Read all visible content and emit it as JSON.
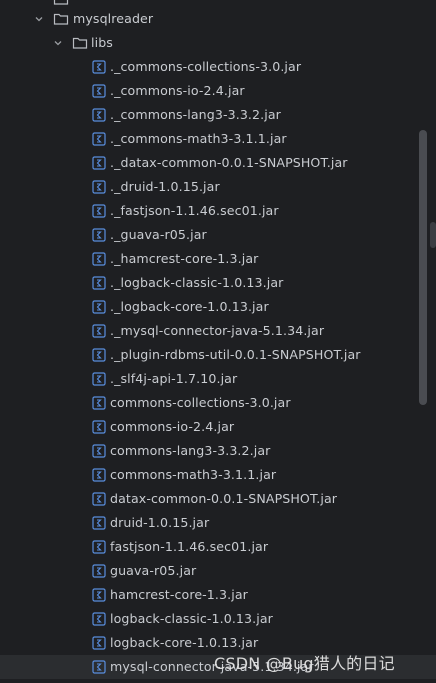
{
  "tree": {
    "partial_top_folder": "...",
    "mysqlreader": {
      "label": "mysqlreader",
      "expanded": true
    },
    "libs": {
      "label": "libs",
      "expanded": true
    },
    "files": [
      "._commons-collections-3.0.jar",
      "._commons-io-2.4.jar",
      "._commons-lang3-3.3.2.jar",
      "._commons-math3-3.1.1.jar",
      "._datax-common-0.0.1-SNAPSHOT.jar",
      "._druid-1.0.15.jar",
      "._fastjson-1.1.46.sec01.jar",
      "._guava-r05.jar",
      "._hamcrest-core-1.3.jar",
      "._logback-classic-1.0.13.jar",
      "._logback-core-1.0.13.jar",
      "._mysql-connector-java-5.1.34.jar",
      "._plugin-rdbms-util-0.0.1-SNAPSHOT.jar",
      "._slf4j-api-1.7.10.jar",
      "commons-collections-3.0.jar",
      "commons-io-2.4.jar",
      "commons-lang3-3.3.2.jar",
      "commons-math3-3.1.1.jar",
      "datax-common-0.0.1-SNAPSHOT.jar",
      "druid-1.0.15.jar",
      "fastjson-1.1.46.sec01.jar",
      "guava-r05.jar",
      "hamcrest-core-1.3.jar",
      "logback-classic-1.0.13.jar",
      "logback-core-1.0.13.jar",
      "mysql-connector-java-5.1.34.jar"
    ]
  },
  "watermark": "CSDN @Bug猎人的日记",
  "colors": {
    "background": "#1e1f22",
    "text": "#c9ccd1",
    "jar_icon": "#5a8fe0",
    "folder_outline": "#b9bcc1",
    "hover_row": "#2b2d30"
  },
  "icons": {
    "expand": "chevron-down-icon",
    "folder": "folder-icon",
    "jar": "jar-archive-icon"
  }
}
